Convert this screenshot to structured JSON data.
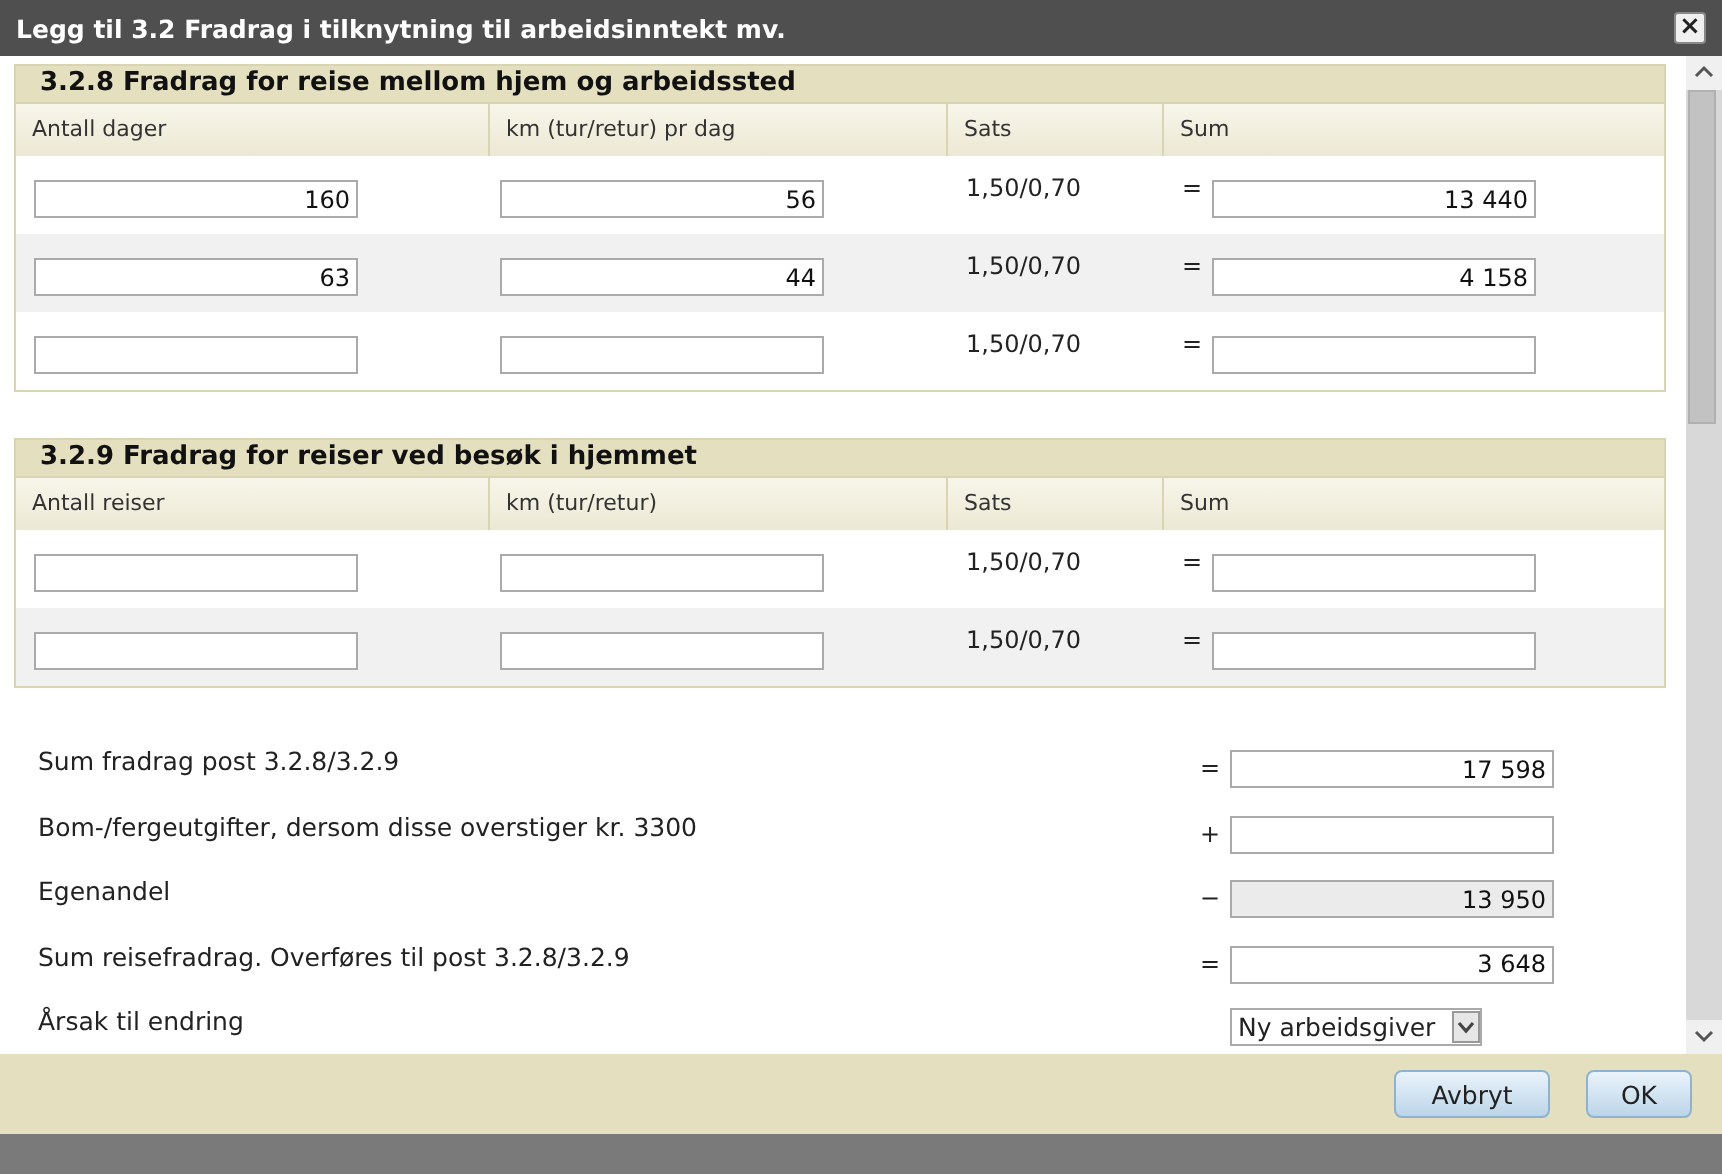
{
  "window": {
    "title": "Legg til 3.2 Fradrag i tilknytning til arbeidsinntekt mv.",
    "close": "×"
  },
  "sections": [
    {
      "title": "3.2.8 Fradrag for reise mellom hjem og arbeidssted",
      "columns": [
        "Antall dager",
        "km (tur/retur) pr dag",
        "Sats",
        "Sum"
      ],
      "rows": [
        {
          "count": "160",
          "km": "56",
          "rate": "1,50/0,70",
          "operator": "=",
          "sum": "13 440"
        },
        {
          "count": "63",
          "km": "44",
          "rate": "1,50/0,70",
          "operator": "=",
          "sum": "4 158"
        },
        {
          "rate": "1,50/0,70",
          "operator": "="
        }
      ]
    },
    {
      "title": "3.2.9 Fradrag for reiser ved besøk i hjemmet",
      "columns": [
        "Antall reiser",
        "km (tur/retur)",
        "Sats",
        "Sum"
      ],
      "rows": [
        {
          "rate": "1,50/0,70",
          "operator": "="
        },
        {
          "rate": "1,50/0,70",
          "operator": "="
        }
      ]
    }
  ],
  "summary": [
    {
      "label": "Sum fradrag post 3.2.8/3.2.9",
      "operator": "=",
      "kind": "input",
      "value": "17 598"
    },
    {
      "label": "Bom-/fergeutgifter, dersom disse overstiger kr. 3300",
      "operator": "+",
      "kind": "input"
    },
    {
      "label": "Egenandel",
      "operator": "−",
      "kind": "readonly",
      "value": "13 950"
    },
    {
      "label": "Sum reisefradrag. Overføres til post 3.2.8/3.2.9",
      "operator": "=",
      "kind": "input",
      "value": "3 648"
    },
    {
      "label": "Årsak til endring",
      "kind": "select",
      "value": "Ny arbeidsgiver"
    }
  ],
  "buttons": [
    "Avbryt",
    "OK"
  ]
}
